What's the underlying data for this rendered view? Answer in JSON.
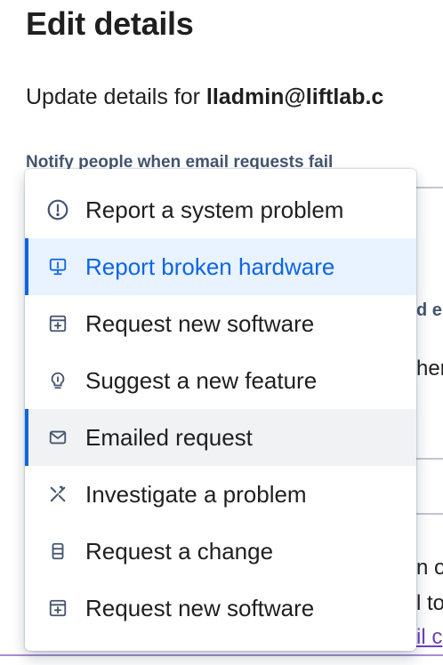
{
  "page": {
    "title": "Edit details",
    "subtitle_prefix": "Update details for ",
    "subtitle_email": "lladmin@liftlab.c",
    "notify_label": "Notify people when email requests fail"
  },
  "background_fragments": {
    "frag_1": "d e",
    "frag_2": "hen",
    "frag_3": "n o",
    "frag_4": "l to",
    "frag_5": "il c"
  },
  "menu": {
    "items": [
      {
        "label": "Report a system problem",
        "icon": "exclamation-circle-icon",
        "state": "default"
      },
      {
        "label": "Report broken hardware",
        "icon": "monitor-icon",
        "state": "selected"
      },
      {
        "label": "Request new software",
        "icon": "window-plus-icon",
        "state": "default"
      },
      {
        "label": "Suggest a new feature",
        "icon": "lightbulb-icon",
        "state": "default"
      },
      {
        "label": "Emailed request",
        "icon": "envelope-icon",
        "state": "hovered"
      },
      {
        "label": "Investigate a problem",
        "icon": "tools-icon",
        "state": "default"
      },
      {
        "label": "Request a change",
        "icon": "server-icon",
        "state": "default"
      },
      {
        "label": "Request new software",
        "icon": "window-plus-icon",
        "state": "default"
      }
    ]
  },
  "colors": {
    "selected_text": "#0c66e4",
    "selected_bg": "#e9f2ff",
    "hover_bg": "#f1f2f4",
    "accent_bar": "#0c66e4"
  }
}
